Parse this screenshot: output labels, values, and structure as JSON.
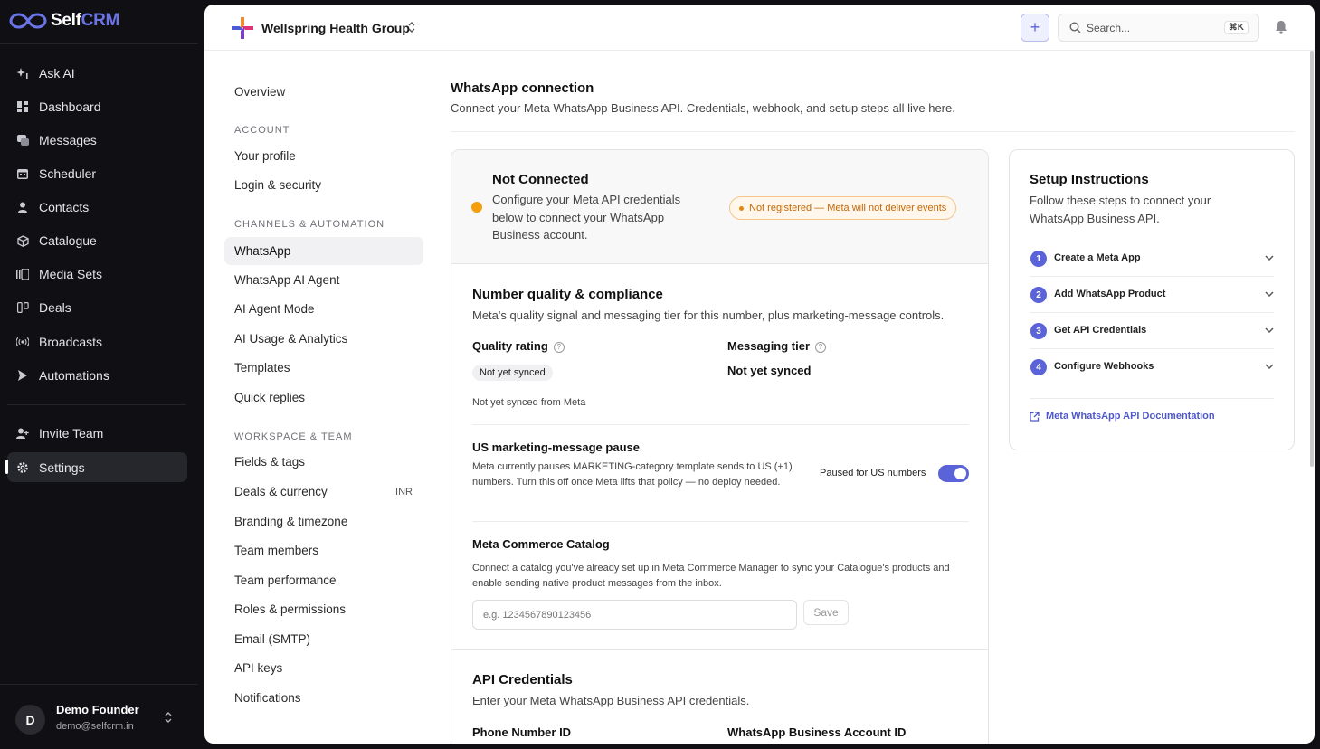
{
  "brand": {
    "self": "Self",
    "crm": "CRM"
  },
  "sidebar": {
    "items": [
      {
        "label": "Ask AI",
        "icon": "sparkle-icon"
      },
      {
        "label": "Dashboard",
        "icon": "dashboard-icon"
      },
      {
        "label": "Messages",
        "icon": "message-icon"
      },
      {
        "label": "Scheduler",
        "icon": "calendar-icon"
      },
      {
        "label": "Contacts",
        "icon": "user-icon"
      },
      {
        "label": "Catalogue",
        "icon": "box-icon"
      },
      {
        "label": "Media Sets",
        "icon": "media-icon"
      },
      {
        "label": "Deals",
        "icon": "deals-icon"
      },
      {
        "label": "Broadcasts",
        "icon": "broadcast-icon"
      },
      {
        "label": "Automations",
        "icon": "automation-icon"
      }
    ],
    "bottom_items": [
      {
        "label": "Invite Team",
        "icon": "invite-icon"
      },
      {
        "label": "Settings",
        "icon": "gear-icon"
      }
    ],
    "user": {
      "initial": "D",
      "name": "Demo Founder",
      "email": "demo@selfcrm.in"
    }
  },
  "topbar": {
    "org_name": "Wellspring Health Group",
    "plus": "+",
    "search_placeholder": "Search...",
    "search_shortcut": "⌘K"
  },
  "settings_nav": {
    "overview": "Overview",
    "sections": [
      {
        "title": "ACCOUNT",
        "items": [
          "Your profile",
          "Login & security"
        ]
      },
      {
        "title": "CHANNELS & AUTOMATION",
        "items": [
          "WhatsApp",
          "WhatsApp AI Agent",
          "AI Agent Mode",
          "AI Usage & Analytics",
          "Templates",
          "Quick replies"
        ]
      },
      {
        "title": "WORKSPACE & TEAM",
        "items": [
          "Fields & tags",
          "Deals & currency",
          "Branding & timezone",
          "Team members",
          "Team performance",
          "Roles & permissions",
          "Email (SMTP)",
          "API keys",
          "Notifications"
        ]
      }
    ],
    "deals_badge": "INR"
  },
  "page": {
    "title": "WhatsApp connection",
    "subtitle": "Connect your Meta WhatsApp Business API. Credentials, webhook, and setup steps all live here."
  },
  "connection": {
    "status": "Not Connected",
    "description": "Configure your Meta API credentials below to connect your WhatsApp Business account.",
    "pill": "Not registered — Meta will not deliver events",
    "status_color": "#f59e0b"
  },
  "quality": {
    "title": "Number quality & compliance",
    "subtitle": "Meta's quality signal and messaging tier for this number, plus marketing-message controls.",
    "quality_label": "Quality rating",
    "quality_value": "Not yet synced",
    "tier_label": "Messaging tier",
    "tier_value": "Not yet synced",
    "sync_note": "Not yet synced from Meta"
  },
  "us_pause": {
    "title": "US marketing-message pause",
    "description": "Meta currently pauses MARKETING-category template sends to US (+1) numbers. Turn this off once Meta lifts that policy — no deploy needed.",
    "toggle_label": "Paused for US numbers",
    "toggle_on": true
  },
  "catalog": {
    "title": "Meta Commerce Catalog",
    "description": "Connect a catalog you've already set up in Meta Commerce Manager to sync your Catalogue's products and enable sending native product messages from the inbox.",
    "placeholder": "e.g. 1234567890123456",
    "save": "Save"
  },
  "api": {
    "title": "API Credentials",
    "subtitle": "Enter your Meta WhatsApp Business API credentials.",
    "phone_label": "Phone Number ID",
    "waba_label": "WhatsApp Business Account ID"
  },
  "setup": {
    "title": "Setup Instructions",
    "description": "Follow these steps to connect your WhatsApp Business API.",
    "steps": [
      {
        "n": "1",
        "label": "Create a Meta App"
      },
      {
        "n": "2",
        "label": "Add WhatsApp Product"
      },
      {
        "n": "3",
        "label": "Get API Credentials"
      },
      {
        "n": "4",
        "label": "Configure Webhooks"
      }
    ],
    "doc_link": "Meta WhatsApp API Documentation"
  },
  "colors": {
    "accent": "#5b63d8",
    "warning": "#f59e0b"
  }
}
